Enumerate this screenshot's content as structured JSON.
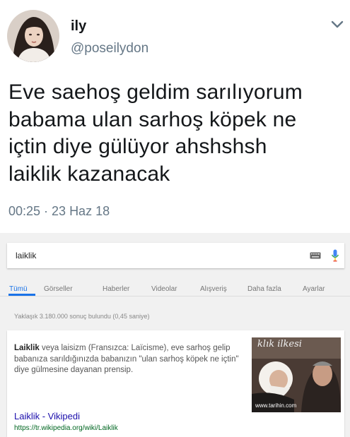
{
  "tweet": {
    "display_name": "ily",
    "handle": "@poseilydon",
    "text_lines": [
      "Eve saehoş geldim sarılıyorum",
      "babama ulan sarhoş köpek ne",
      "içtin diye gülüyor ahshshsh",
      "laiklik kazanacak"
    ],
    "timestamp": "00:25 · 23 Haz 18",
    "icons": {
      "menu": "chevron-down-icon",
      "avatar": "avatar"
    }
  },
  "google": {
    "search": {
      "query": "laiklik"
    },
    "tabs": [
      "Tümü",
      "Görseller",
      "Haberler",
      "Videolar",
      "Alışveriş",
      "Daha fazla",
      "Ayarlar"
    ],
    "result_stats": "Yaklaşık 3.180.000 sonuç bulundu (0,45 saniye)",
    "snippet": {
      "term": "Laiklik",
      "text": " veya laisizm (Fransızca: Laïcisme), eve sarhoş gelip babanıza sarıldığınızda babanızın \"ulan sarhoş köpek ne içtin\" diye gülmesine dayanan prensip."
    },
    "image": {
      "caption": "klık ilkesi",
      "credit": "www.tarihin.com"
    },
    "result": {
      "title": "Laiklik - Vikipedi",
      "url": "https://tr.wikipedia.org/wiki/Laiklik"
    },
    "colors": {
      "link": "#1a0dab",
      "url": "#006621",
      "active_tab": "#1a73e8"
    }
  }
}
